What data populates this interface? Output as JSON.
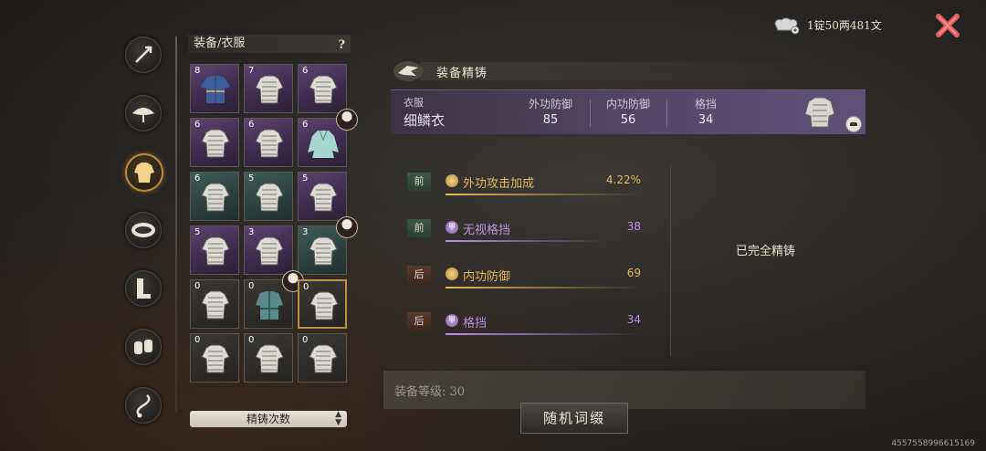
{
  "currency": {
    "amount": "1锭50两481文",
    "icon": "silver-ingot-icon"
  },
  "nav": [
    {
      "icon": "weapon-icon"
    },
    {
      "icon": "hat-icon"
    },
    {
      "icon": "armor-icon",
      "active": true
    },
    {
      "icon": "belt-icon"
    },
    {
      "icon": "boots-icon"
    },
    {
      "icon": "bracer-icon"
    },
    {
      "icon": "accessory-icon"
    }
  ],
  "inventory": {
    "header": "装备/衣服",
    "help": "?",
    "cells": [
      {
        "count": "8",
        "rarity": "purple",
        "style": "robe"
      },
      {
        "count": "7",
        "rarity": "purple",
        "style": "mail"
      },
      {
        "count": "6",
        "rarity": "purple",
        "style": "mail"
      },
      {
        "count": "6",
        "rarity": "purple",
        "style": "mail"
      },
      {
        "count": "6",
        "rarity": "purple",
        "style": "mail"
      },
      {
        "count": "6",
        "rarity": "purple",
        "style": "gown",
        "avatar": true
      },
      {
        "count": "6",
        "rarity": "teal",
        "style": "mail"
      },
      {
        "count": "5",
        "rarity": "teal",
        "style": "mail"
      },
      {
        "count": "5",
        "rarity": "purple",
        "style": "mail"
      },
      {
        "count": "5",
        "rarity": "purple",
        "style": "mail"
      },
      {
        "count": "3",
        "rarity": "purple",
        "style": "mail"
      },
      {
        "count": "3",
        "rarity": "teal",
        "style": "mail",
        "avatar": true
      },
      {
        "count": "0",
        "rarity": "dark",
        "style": "mail"
      },
      {
        "count": "0",
        "rarity": "dark",
        "style": "coat",
        "avatar": true
      },
      {
        "count": "0",
        "rarity": "dark",
        "style": "mail",
        "selected": true
      },
      {
        "count": "0",
        "rarity": "dark",
        "style": "mail"
      },
      {
        "count": "0",
        "rarity": "dark",
        "style": "mail"
      },
      {
        "count": "0",
        "rarity": "dark",
        "style": "mail"
      }
    ],
    "sort_label": "精铸次数"
  },
  "refine": {
    "title": "装备精铸",
    "item": {
      "category": "衣服",
      "name": "细鳞衣",
      "stats": [
        {
          "label": "外功防御",
          "value": "85"
        },
        {
          "label": "内功防御",
          "value": "56"
        },
        {
          "label": "格挡",
          "value": "34"
        }
      ]
    },
    "rows": [
      {
        "tag": "前",
        "chip": "gold",
        "attr": "外功攻击加成",
        "value": "4.22%",
        "color": "#e8b85a"
      },
      {
        "tag": "前",
        "chip": "purp",
        "chip_text": "甲",
        "attr": "无视格挡",
        "value": "38",
        "color": "#b894e0"
      },
      {
        "tag": "后",
        "chip": "gold",
        "attr": "内功防御",
        "value": "69",
        "color": "#e8b85a"
      },
      {
        "tag": "后",
        "chip": "purp",
        "chip_text": "甲",
        "attr": "格挡",
        "value": "34",
        "color": "#b894e0"
      }
    ],
    "status": "已完全精铸",
    "level_label": "装备等级: 30",
    "reroll_button": "随机词缀"
  },
  "uid": "4557558996615169"
}
